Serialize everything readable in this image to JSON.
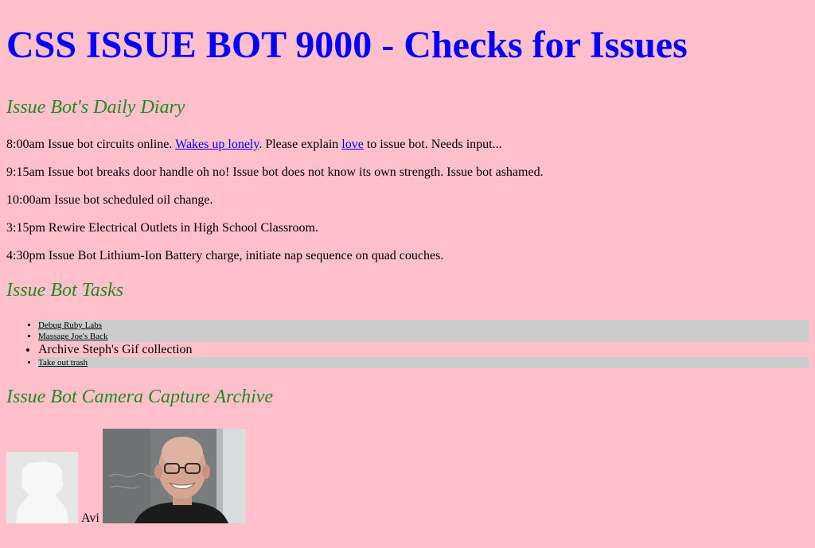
{
  "page_title": "CSS ISSUE BOT 9000 - Checks for Issues",
  "diary": {
    "heading": "Issue Bot's Daily Diary",
    "entry1": {
      "before": "8:00am Issue bot circuits online. ",
      "link1": "Wakes up lonely",
      "middle": ". Please explain ",
      "link2": "love",
      "after": " to issue bot. Needs input..."
    },
    "entry2": "9:15am Issue bot breaks door handle oh no! Issue bot does not know its own strength. Issue bot ashamed.",
    "entry3": "10:00am Issue bot scheduled oil change.",
    "entry4": "3:15pm Rewire Electrical Outlets in High School Classroom.",
    "entry5": "4:30pm Issue Bot Lithium-Ion Battery charge, initiate nap sequence on quad couches."
  },
  "tasks": {
    "heading": "Issue Bot Tasks",
    "items": [
      "Debug Ruby Labs",
      "Massage Joe's Back",
      "Archive Steph's Gif collection",
      "Take out trash"
    ]
  },
  "camera": {
    "heading": "Issue Bot Camera Capture Archive",
    "caption": "Avi"
  },
  "colors": {
    "background": "#ffc0cb",
    "title": "#0000ff",
    "heading": "#228b22",
    "task_highlight": "#cccccc"
  }
}
